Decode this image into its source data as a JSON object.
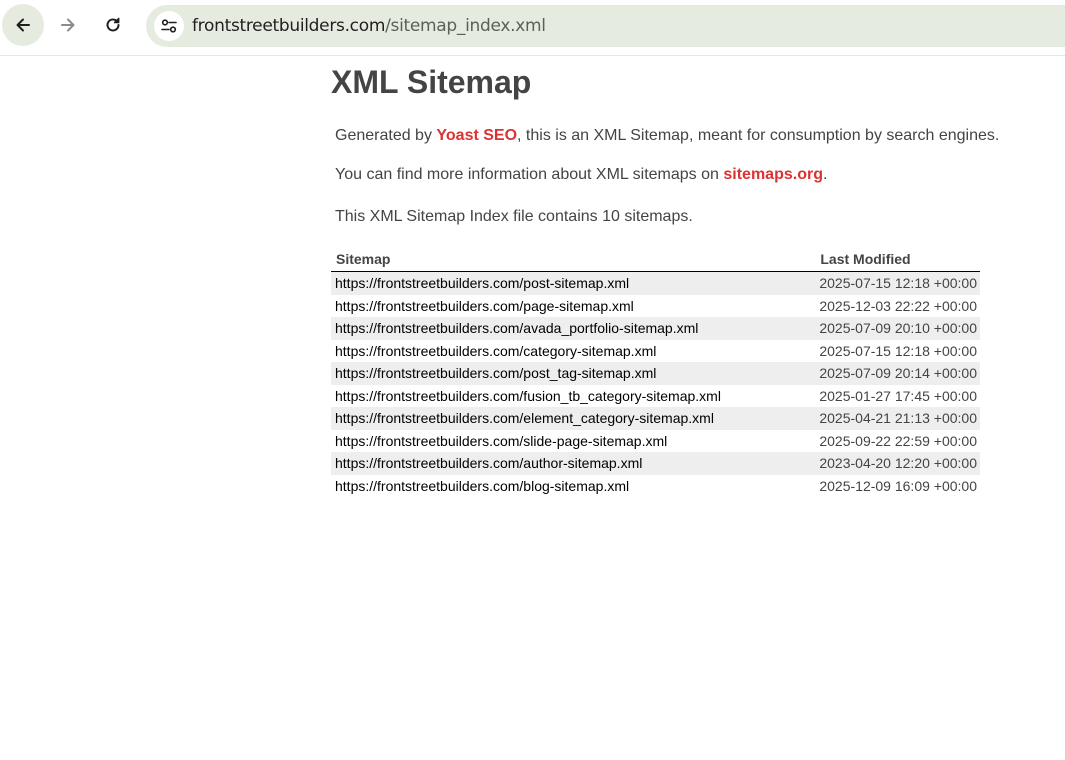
{
  "browser": {
    "url_host": "frontstreetbuilders.com",
    "url_path": "/sitemap_index.xml",
    "icons": {
      "back": "back-arrow-icon",
      "forward": "forward-arrow-icon",
      "reload": "reload-icon",
      "site_info": "site-info-tune-icon"
    }
  },
  "page": {
    "title": "XML Sitemap",
    "intro1_prefix": "Generated by ",
    "intro1_link": "Yoast SEO",
    "intro1_suffix": ", this is an XML Sitemap, meant for consumption by search engines.",
    "intro2_prefix": "You can find more information about XML sitemaps on ",
    "intro2_link": "sitemaps.org",
    "intro2_suffix": ".",
    "intro3": "This XML Sitemap Index file contains 10 sitemaps.",
    "link_color": "#dc3232"
  },
  "table": {
    "headers": {
      "sitemap": "Sitemap",
      "last_modified": "Last Modified"
    },
    "rows": [
      {
        "loc": "https://frontstreetbuilders.com/post-sitemap.xml",
        "lastmod": "2025-07-15 12:18 +00:00"
      },
      {
        "loc": "https://frontstreetbuilders.com/page-sitemap.xml",
        "lastmod": "2025-12-03 22:22 +00:00"
      },
      {
        "loc": "https://frontstreetbuilders.com/avada_portfolio-sitemap.xml",
        "lastmod": "2025-07-09 20:10 +00:00"
      },
      {
        "loc": "https://frontstreetbuilders.com/category-sitemap.xml",
        "lastmod": "2025-07-15 12:18 +00:00"
      },
      {
        "loc": "https://frontstreetbuilders.com/post_tag-sitemap.xml",
        "lastmod": "2025-07-09 20:14 +00:00"
      },
      {
        "loc": "https://frontstreetbuilders.com/fusion_tb_category-sitemap.xml",
        "lastmod": "2025-01-27 17:45 +00:00"
      },
      {
        "loc": "https://frontstreetbuilders.com/element_category-sitemap.xml",
        "lastmod": "2025-04-21 21:13 +00:00"
      },
      {
        "loc": "https://frontstreetbuilders.com/slide-page-sitemap.xml",
        "lastmod": "2025-09-22 22:59 +00:00"
      },
      {
        "loc": "https://frontstreetbuilders.com/author-sitemap.xml",
        "lastmod": "2023-04-20 12:20 +00:00"
      },
      {
        "loc": "https://frontstreetbuilders.com/blog-sitemap.xml",
        "lastmod": "2025-12-09 16:09 +00:00"
      }
    ]
  }
}
